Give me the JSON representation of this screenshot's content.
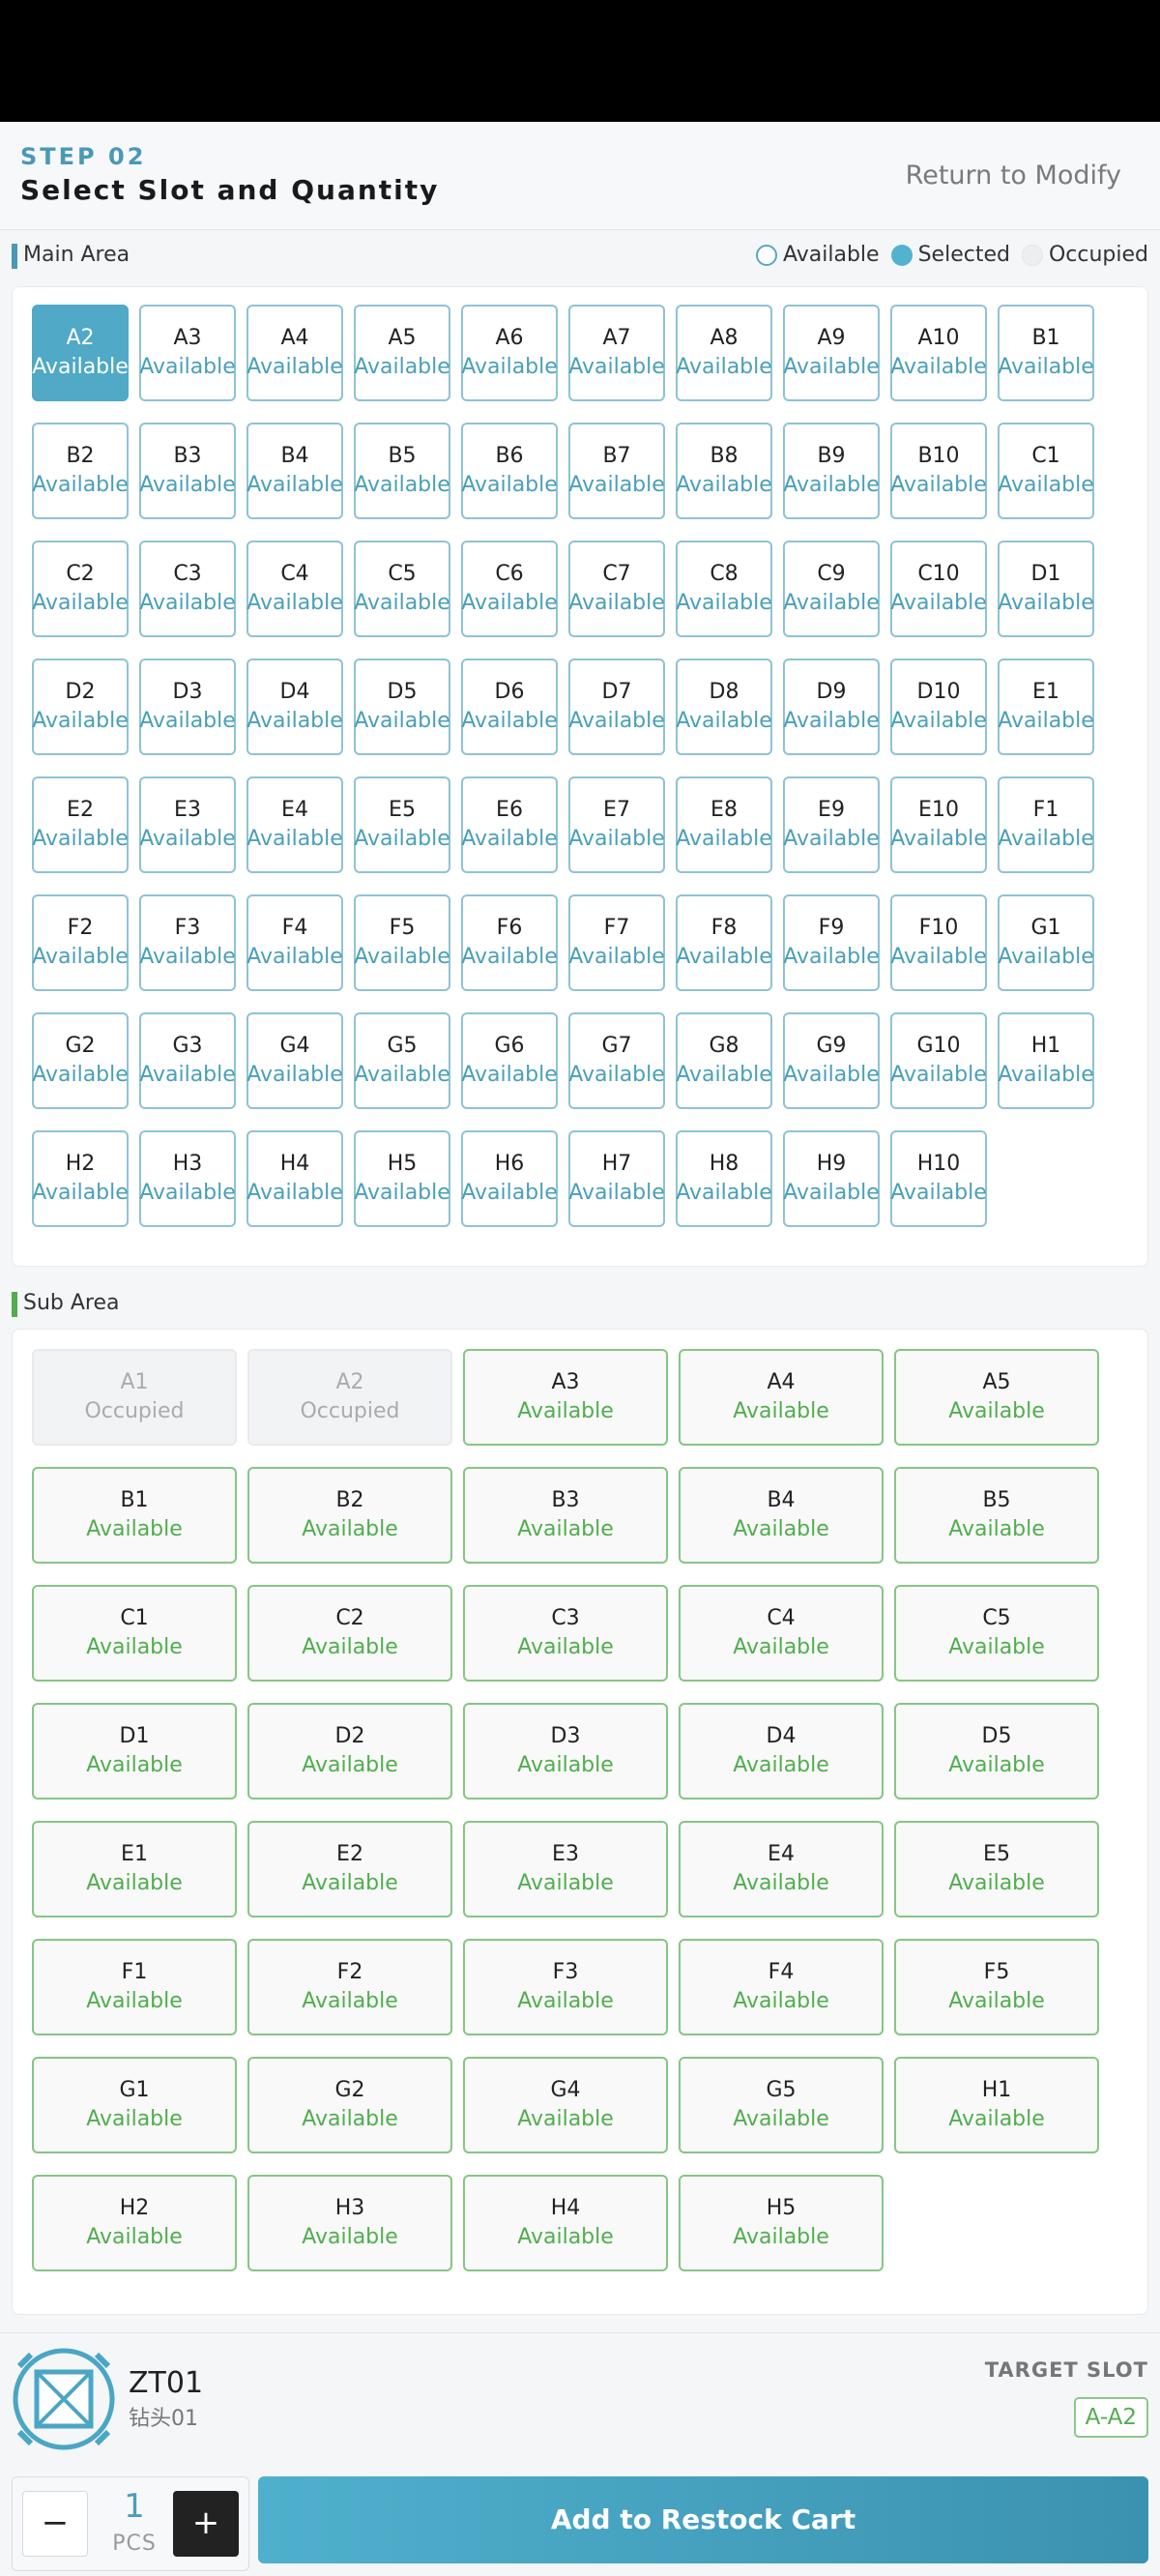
{
  "header": {
    "step": "STEP 02",
    "title": "Select Slot and Quantity",
    "return_label": "Return to Modify"
  },
  "main_area": {
    "title": "Main Area",
    "accent_color": "#4a98b8",
    "legend": {
      "available": "Available",
      "selected": "Selected",
      "occupied": "Occupied"
    },
    "slots": [
      {
        "code": "A2",
        "status": "Available",
        "state": "selected"
      },
      {
        "code": "A3",
        "status": "Available",
        "state": "available"
      },
      {
        "code": "A4",
        "status": "Available",
        "state": "available"
      },
      {
        "code": "A5",
        "status": "Available",
        "state": "available"
      },
      {
        "code": "A6",
        "status": "Available",
        "state": "available"
      },
      {
        "code": "A7",
        "status": "Available",
        "state": "available"
      },
      {
        "code": "A8",
        "status": "Available",
        "state": "available"
      },
      {
        "code": "A9",
        "status": "Available",
        "state": "available"
      },
      {
        "code": "A10",
        "status": "Available",
        "state": "available"
      },
      {
        "code": "B1",
        "status": "Available",
        "state": "available"
      },
      {
        "code": "B2",
        "status": "Available",
        "state": "available"
      },
      {
        "code": "B3",
        "status": "Available",
        "state": "available"
      },
      {
        "code": "B4",
        "status": "Available",
        "state": "available"
      },
      {
        "code": "B5",
        "status": "Available",
        "state": "available"
      },
      {
        "code": "B6",
        "status": "Available",
        "state": "available"
      },
      {
        "code": "B7",
        "status": "Available",
        "state": "available"
      },
      {
        "code": "B8",
        "status": "Available",
        "state": "available"
      },
      {
        "code": "B9",
        "status": "Available",
        "state": "available"
      },
      {
        "code": "B10",
        "status": "Available",
        "state": "available"
      },
      {
        "code": "C1",
        "status": "Available",
        "state": "available"
      },
      {
        "code": "C2",
        "status": "Available",
        "state": "available"
      },
      {
        "code": "C3",
        "status": "Available",
        "state": "available"
      },
      {
        "code": "C4",
        "status": "Available",
        "state": "available"
      },
      {
        "code": "C5",
        "status": "Available",
        "state": "available"
      },
      {
        "code": "C6",
        "status": "Available",
        "state": "available"
      },
      {
        "code": "C7",
        "status": "Available",
        "state": "available"
      },
      {
        "code": "C8",
        "status": "Available",
        "state": "available"
      },
      {
        "code": "C9",
        "status": "Available",
        "state": "available"
      },
      {
        "code": "C10",
        "status": "Available",
        "state": "available"
      },
      {
        "code": "D1",
        "status": "Available",
        "state": "available"
      },
      {
        "code": "D2",
        "status": "Available",
        "state": "available"
      },
      {
        "code": "D3",
        "status": "Available",
        "state": "available"
      },
      {
        "code": "D4",
        "status": "Available",
        "state": "available"
      },
      {
        "code": "D5",
        "status": "Available",
        "state": "available"
      },
      {
        "code": "D6",
        "status": "Available",
        "state": "available"
      },
      {
        "code": "D7",
        "status": "Available",
        "state": "available"
      },
      {
        "code": "D8",
        "status": "Available",
        "state": "available"
      },
      {
        "code": "D9",
        "status": "Available",
        "state": "available"
      },
      {
        "code": "D10",
        "status": "Available",
        "state": "available"
      },
      {
        "code": "E1",
        "status": "Available",
        "state": "available"
      },
      {
        "code": "E2",
        "status": "Available",
        "state": "available"
      },
      {
        "code": "E3",
        "status": "Available",
        "state": "available"
      },
      {
        "code": "E4",
        "status": "Available",
        "state": "available"
      },
      {
        "code": "E5",
        "status": "Available",
        "state": "available"
      },
      {
        "code": "E6",
        "status": "Available",
        "state": "available"
      },
      {
        "code": "E7",
        "status": "Available",
        "state": "available"
      },
      {
        "code": "E8",
        "status": "Available",
        "state": "available"
      },
      {
        "code": "E9",
        "status": "Available",
        "state": "available"
      },
      {
        "code": "E10",
        "status": "Available",
        "state": "available"
      },
      {
        "code": "F1",
        "status": "Available",
        "state": "available"
      },
      {
        "code": "F2",
        "status": "Available",
        "state": "available"
      },
      {
        "code": "F3",
        "status": "Available",
        "state": "available"
      },
      {
        "code": "F4",
        "status": "Available",
        "state": "available"
      },
      {
        "code": "F5",
        "status": "Available",
        "state": "available"
      },
      {
        "code": "F6",
        "status": "Available",
        "state": "available"
      },
      {
        "code": "F7",
        "status": "Available",
        "state": "available"
      },
      {
        "code": "F8",
        "status": "Available",
        "state": "available"
      },
      {
        "code": "F9",
        "status": "Available",
        "state": "available"
      },
      {
        "code": "F10",
        "status": "Available",
        "state": "available"
      },
      {
        "code": "G1",
        "status": "Available",
        "state": "available"
      },
      {
        "code": "G2",
        "status": "Available",
        "state": "available"
      },
      {
        "code": "G3",
        "status": "Available",
        "state": "available"
      },
      {
        "code": "G4",
        "status": "Available",
        "state": "available"
      },
      {
        "code": "G5",
        "status": "Available",
        "state": "available"
      },
      {
        "code": "G6",
        "status": "Available",
        "state": "available"
      },
      {
        "code": "G7",
        "status": "Available",
        "state": "available"
      },
      {
        "code": "G8",
        "status": "Available",
        "state": "available"
      },
      {
        "code": "G9",
        "status": "Available",
        "state": "available"
      },
      {
        "code": "G10",
        "status": "Available",
        "state": "available"
      },
      {
        "code": "H1",
        "status": "Available",
        "state": "available"
      },
      {
        "code": "H2",
        "status": "Available",
        "state": "available"
      },
      {
        "code": "H3",
        "status": "Available",
        "state": "available"
      },
      {
        "code": "H4",
        "status": "Available",
        "state": "available"
      },
      {
        "code": "H5",
        "status": "Available",
        "state": "available"
      },
      {
        "code": "H6",
        "status": "Available",
        "state": "available"
      },
      {
        "code": "H7",
        "status": "Available",
        "state": "available"
      },
      {
        "code": "H8",
        "status": "Available",
        "state": "available"
      },
      {
        "code": "H9",
        "status": "Available",
        "state": "available"
      },
      {
        "code": "H10",
        "status": "Available",
        "state": "available"
      }
    ]
  },
  "sub_area": {
    "title": "Sub Area",
    "accent_color": "#52ad4f",
    "slots": [
      {
        "code": "A1",
        "status": "Occupied",
        "state": "occupied"
      },
      {
        "code": "A2",
        "status": "Occupied",
        "state": "occupied"
      },
      {
        "code": "A3",
        "status": "Available",
        "state": "available"
      },
      {
        "code": "A4",
        "status": "Available",
        "state": "available"
      },
      {
        "code": "A5",
        "status": "Available",
        "state": "available"
      },
      {
        "code": "B1",
        "status": "Available",
        "state": "available"
      },
      {
        "code": "B2",
        "status": "Available",
        "state": "available"
      },
      {
        "code": "B3",
        "status": "Available",
        "state": "available"
      },
      {
        "code": "B4",
        "status": "Available",
        "state": "available"
      },
      {
        "code": "B5",
        "status": "Available",
        "state": "available"
      },
      {
        "code": "C1",
        "status": "Available",
        "state": "available"
      },
      {
        "code": "C2",
        "status": "Available",
        "state": "available"
      },
      {
        "code": "C3",
        "status": "Available",
        "state": "available"
      },
      {
        "code": "C4",
        "status": "Available",
        "state": "available"
      },
      {
        "code": "C5",
        "status": "Available",
        "state": "available"
      },
      {
        "code": "D1",
        "status": "Available",
        "state": "available"
      },
      {
        "code": "D2",
        "status": "Available",
        "state": "available"
      },
      {
        "code": "D3",
        "status": "Available",
        "state": "available"
      },
      {
        "code": "D4",
        "status": "Available",
        "state": "available"
      },
      {
        "code": "D5",
        "status": "Available",
        "state": "available"
      },
      {
        "code": "E1",
        "status": "Available",
        "state": "available"
      },
      {
        "code": "E2",
        "status": "Available",
        "state": "available"
      },
      {
        "code": "E3",
        "status": "Available",
        "state": "available"
      },
      {
        "code": "E4",
        "status": "Available",
        "state": "available"
      },
      {
        "code": "E5",
        "status": "Available",
        "state": "available"
      },
      {
        "code": "F1",
        "status": "Available",
        "state": "available"
      },
      {
        "code": "F2",
        "status": "Available",
        "state": "available"
      },
      {
        "code": "F3",
        "status": "Available",
        "state": "available"
      },
      {
        "code": "F4",
        "status": "Available",
        "state": "available"
      },
      {
        "code": "F5",
        "status": "Available",
        "state": "available"
      },
      {
        "code": "G1",
        "status": "Available",
        "state": "available"
      },
      {
        "code": "G2",
        "status": "Available",
        "state": "available"
      },
      {
        "code": "G4",
        "status": "Available",
        "state": "available"
      },
      {
        "code": "G5",
        "status": "Available",
        "state": "available"
      },
      {
        "code": "H1",
        "status": "Available",
        "state": "available"
      },
      {
        "code": "H2",
        "status": "Available",
        "state": "available"
      },
      {
        "code": "H3",
        "status": "Available",
        "state": "available"
      },
      {
        "code": "H4",
        "status": "Available",
        "state": "available"
      },
      {
        "code": "H5",
        "status": "Available",
        "state": "available"
      }
    ]
  },
  "product": {
    "icon": "drill-bit-box-icon",
    "code": "ZT01",
    "name": "钻头01",
    "target_label": "TARGET SLOT",
    "target_slot": "A-A2"
  },
  "quantity": {
    "minus": "−",
    "value": "1",
    "unit": "PCS",
    "plus": "+"
  },
  "add_button_label": "Add to Restock Cart"
}
